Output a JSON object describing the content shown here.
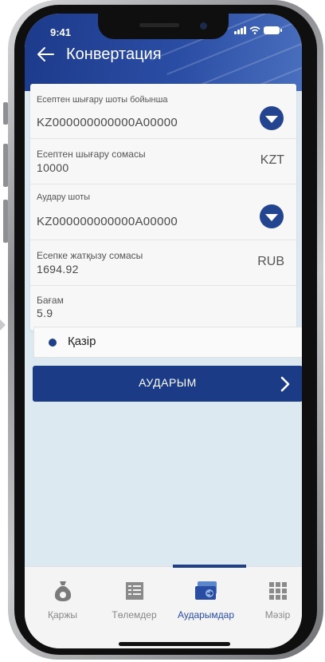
{
  "status_bar": {
    "time": "9:41"
  },
  "header": {
    "title": "Конвертация"
  },
  "form": {
    "from_account_label": "Есептен шығару шоты бойынша",
    "from_account_value": "KZ000000000000A00000",
    "debit_amount_label": "Есептен шығару сомасы",
    "debit_amount_value": "10000",
    "debit_currency": "KZT",
    "to_account_label": "Аудару шоты",
    "to_account_value": "KZ000000000000A00000",
    "credit_amount_label": "Есепке жатқызу сомасы",
    "credit_amount_value": "1694.92",
    "credit_currency": "RUB",
    "rate_label": "Бағам",
    "rate_value": "5.9"
  },
  "now_option": {
    "label": "Қазір",
    "selected": true
  },
  "transfer_button": {
    "label": "АУДАРЫМ"
  },
  "tabbar": {
    "tabs": [
      {
        "label": "Қаржы",
        "icon": "money-bag-icon",
        "active": false
      },
      {
        "label": "Төлемдер",
        "icon": "payments-list-icon",
        "active": false
      },
      {
        "label": "Аударымдар",
        "icon": "transfer-card-icon",
        "active": true
      },
      {
        "label": "Мәзір",
        "icon": "grid-menu-icon",
        "active": false
      }
    ]
  },
  "colors": {
    "primary": "#1b3b86",
    "screen_bg": "#dde9f1",
    "active_tab": "#2a4da4"
  }
}
